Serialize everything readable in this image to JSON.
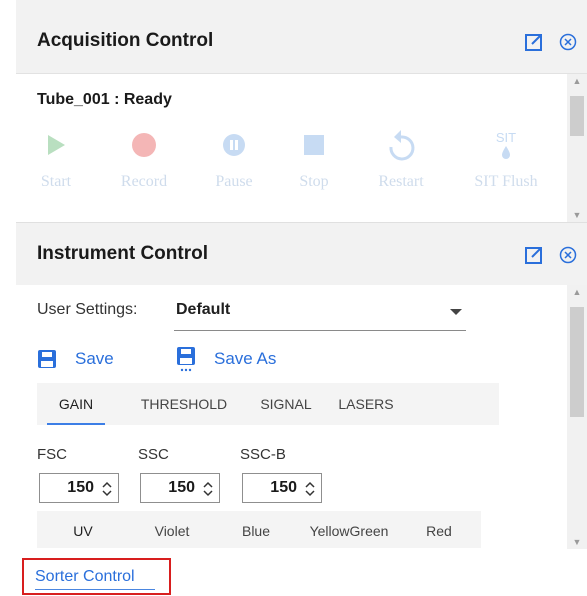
{
  "acquisition": {
    "title": "Acquisition Control",
    "tube_status": "Tube_001 : Ready",
    "buttons": [
      {
        "label": "Start",
        "icon": "play-icon"
      },
      {
        "label": "Record",
        "icon": "record-icon"
      },
      {
        "label": "Pause",
        "icon": "pause-icon"
      },
      {
        "label": "Stop",
        "icon": "stop-icon"
      },
      {
        "label": "Restart",
        "icon": "restart-icon"
      },
      {
        "label": "SIT Flush",
        "icon": "sit-flush-icon",
        "icon_text": "SIT"
      }
    ]
  },
  "instrument": {
    "title": "Instrument Control",
    "user_settings_label": "User Settings:",
    "user_settings_value": "Default",
    "save_label": "Save",
    "save_as_label": "Save As",
    "tabs": [
      "GAIN",
      "THRESHOLD",
      "SIGNAL",
      "LASERS"
    ],
    "active_tab": "GAIN",
    "fields": [
      {
        "label": "FSC",
        "value": "150"
      },
      {
        "label": "SSC",
        "value": "150"
      },
      {
        "label": "SSC-B",
        "value": "150"
      }
    ],
    "laser_tabs": [
      "UV",
      "Violet",
      "Blue",
      "YellowGreen",
      "Red"
    ],
    "active_laser_tab": "UV"
  },
  "sorter": {
    "label": "Sorter Control"
  },
  "colors": {
    "accent": "#2a6fdb",
    "highlight_border": "#d81e1e",
    "header_bg": "#f2f2f2",
    "disabled_icon": "#c7d7ea"
  }
}
